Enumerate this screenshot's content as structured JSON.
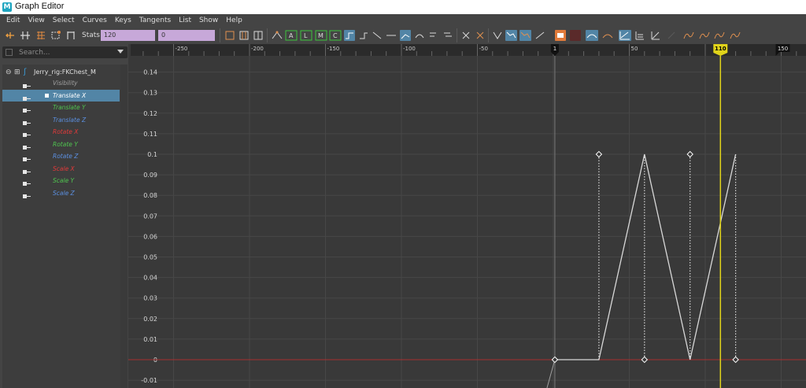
{
  "window": {
    "title": "Graph Editor",
    "logo_letter": "M"
  },
  "menu": [
    "Edit",
    "View",
    "Select",
    "Curves",
    "Keys",
    "Tangents",
    "List",
    "Show",
    "Help"
  ],
  "toolbar": {
    "stats_label": "Stats",
    "stats_frame": "120",
    "stats_value": "0",
    "icon_labels": {
      "a": "A",
      "l": "L",
      "m": "M",
      "c": "C"
    }
  },
  "outliner": {
    "search_placeholder": "Search...",
    "node_label": "Jerry_rig:FKChest_M",
    "channels": [
      {
        "name": "Visibility",
        "color": "#a0a0a0",
        "selected": false
      },
      {
        "name": "Translate X",
        "color": "#ffffff",
        "selected": true
      },
      {
        "name": "Translate Y",
        "color": "#4fc44f",
        "selected": false
      },
      {
        "name": "Translate Z",
        "color": "#5b8fe0",
        "selected": false
      },
      {
        "name": "Rotate X",
        "color": "#e03a3a",
        "selected": false
      },
      {
        "name": "Rotate Y",
        "color": "#4fc44f",
        "selected": false
      },
      {
        "name": "Rotate Z",
        "color": "#5b8fe0",
        "selected": false
      },
      {
        "name": "Scale X",
        "color": "#e03a3a",
        "selected": false
      },
      {
        "name": "Scale Y",
        "color": "#4fc44f",
        "selected": false
      },
      {
        "name": "Scale Z",
        "color": "#5b8fe0",
        "selected": false
      }
    ]
  },
  "graph": {
    "ruler_labels": [
      "-250",
      "-200",
      "-150",
      "-100",
      "-50",
      "0",
      "50",
      "100",
      "150"
    ],
    "ruler_values": [
      -250,
      -200,
      -150,
      -100,
      -50,
      0,
      50,
      100,
      150
    ],
    "y_labels": [
      "0.14",
      "0.13",
      "0.12",
      "0.11",
      "0.1",
      "0.09",
      "0.08",
      "0.07",
      "0.06",
      "0.05",
      "0.04",
      "0.03",
      "0.02",
      "0.01",
      "0",
      "-0.01"
    ],
    "y_values": [
      0.14,
      0.13,
      0.12,
      0.11,
      0.1,
      0.09,
      0.08,
      0.07,
      0.06,
      0.05,
      0.04,
      0.03,
      0.02,
      0.01,
      0,
      -0.01
    ],
    "current_frame": "110",
    "current_frame_value": 110,
    "range_start_label": "1",
    "range_start_value": 1,
    "range_end_label": "150",
    "range_end_value": 150,
    "keys": [
      {
        "frame": 1,
        "value": 0
      },
      {
        "frame": 30,
        "value": 0.1
      },
      {
        "frame": 60,
        "value": 0
      },
      {
        "frame": 90,
        "value": 0.1
      },
      {
        "frame": 120,
        "value": 0
      }
    ],
    "colors": {
      "curve": "#d8d8d8",
      "zero_line": "#a82f2f",
      "current_time": "#e0d31a",
      "range_marker": "#111111"
    }
  }
}
